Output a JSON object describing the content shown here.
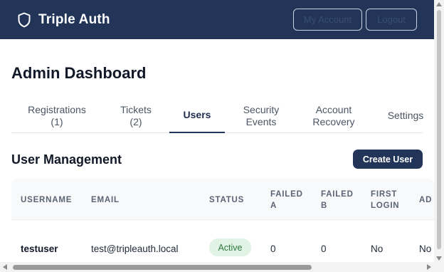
{
  "app": {
    "brand_name": "Triple Auth",
    "brand_icon": "shield-icon"
  },
  "header": {
    "my_account_label": "My Account",
    "logout_label": "Logout"
  },
  "page": {
    "title": "Admin Dashboard"
  },
  "tabs": [
    {
      "label": "Registrations\n(1)",
      "active": false
    },
    {
      "label": "Tickets\n(2)",
      "active": false
    },
    {
      "label": "Users",
      "active": true
    },
    {
      "label": "Security\nEvents",
      "active": false
    },
    {
      "label": "Account\nRecovery",
      "active": false
    },
    {
      "label": "Settings",
      "active": false
    }
  ],
  "users_section": {
    "title": "User Management",
    "create_button_label": "Create User",
    "columns": [
      "USERNAME",
      "EMAIL",
      "STATUS",
      "FAILED\nA",
      "FAILED\nB",
      "FIRST\nLOGIN",
      "AD"
    ],
    "rows": [
      {
        "username": "testuser",
        "email": "test@tripleauth.local",
        "status": "Active",
        "failed_a": "0",
        "failed_b": "0",
        "first_login": "No",
        "admin": "No"
      }
    ]
  },
  "colors": {
    "header_bg": "#223458",
    "accent": "#223458",
    "active_badge_bg": "#e1f3e4",
    "active_badge_text": "#2f7a3f"
  }
}
